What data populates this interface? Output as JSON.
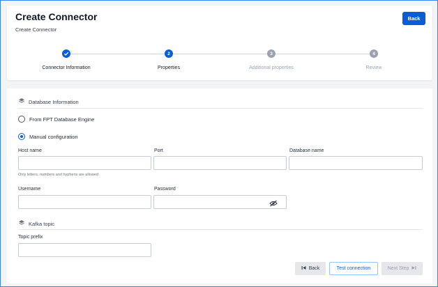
{
  "header": {
    "title": "Create Connector",
    "subtitle": "Create Connector",
    "back_label": "Back"
  },
  "stepper": {
    "steps": [
      {
        "label": "Connector Information",
        "status": "done",
        "number": ""
      },
      {
        "label": "Properties",
        "status": "active",
        "number": "2"
      },
      {
        "label": "Additional properties",
        "status": "pending",
        "number": "3"
      },
      {
        "label": "Review",
        "status": "pending",
        "number": "4"
      }
    ]
  },
  "database_section": {
    "title": "Database Information",
    "options": [
      {
        "label": "From FPT Database Engine",
        "checked": false
      },
      {
        "label": "Manual configuration",
        "checked": true
      }
    ],
    "host": {
      "label": "Host name",
      "value": "",
      "hint": "Only letters, numbers and hyphens are allowed"
    },
    "port": {
      "label": "Port",
      "value": ""
    },
    "dbname": {
      "label": "Database name",
      "value": ""
    },
    "username": {
      "label": "Username",
      "value": ""
    },
    "password": {
      "label": "Password",
      "value": ""
    }
  },
  "kafka_section": {
    "title": "Kafka topic",
    "topic_prefix": {
      "label": "Topic prefix",
      "value": ""
    }
  },
  "footer": {
    "back_label": "Back",
    "test_label": "Test connection",
    "next_label": "Next Step"
  },
  "colors": {
    "primary": "#0b5cd8",
    "pending": "#9ca3af",
    "border": "#c7ccd4"
  }
}
